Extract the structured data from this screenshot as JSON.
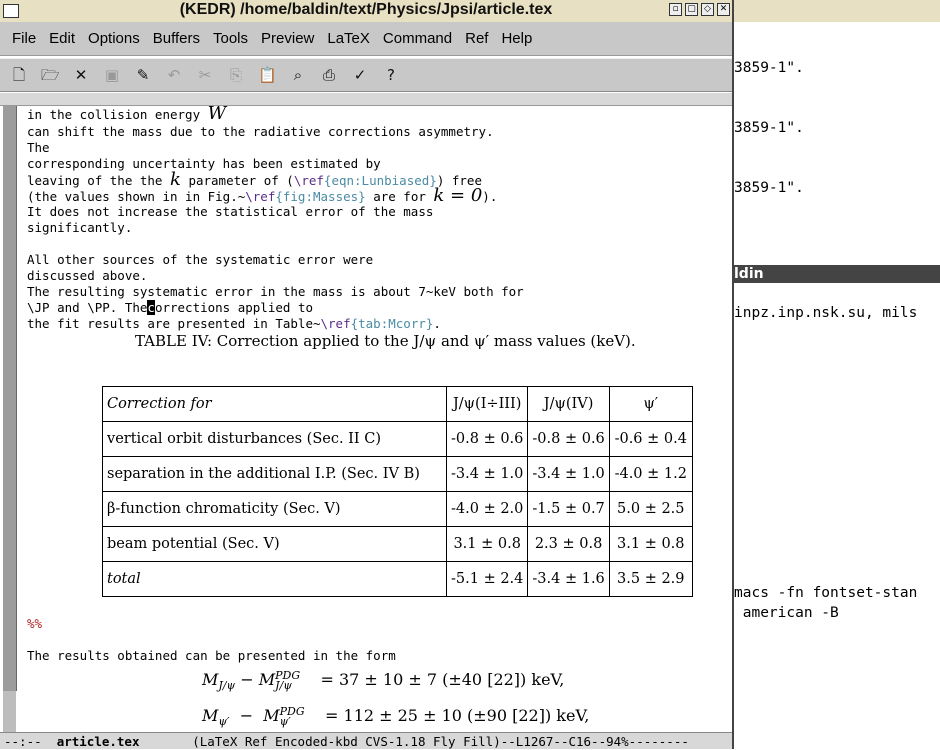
{
  "window": {
    "title": "(KEDR) /home/baldin/text/Physics/Jpsi/article.tex"
  },
  "menu": [
    "File",
    "Edit",
    "Options",
    "Buffers",
    "Tools",
    "Preview",
    "LaTeX",
    "Command",
    "Ref",
    "Help"
  ],
  "toolbar": [
    {
      "icon": "new-file-icon"
    },
    {
      "icon": "open-folder-icon"
    },
    {
      "icon": "close-icon"
    },
    {
      "icon": "save-icon",
      "disabled": true
    },
    {
      "icon": "save-as-icon"
    },
    {
      "icon": "undo-icon",
      "disabled": true
    },
    {
      "icon": "cut-icon",
      "disabled": true
    },
    {
      "icon": "copy-icon",
      "disabled": true
    },
    {
      "icon": "paste-icon"
    },
    {
      "icon": "search-icon"
    },
    {
      "icon": "print-icon"
    },
    {
      "icon": "customize-icon"
    },
    {
      "icon": "help-icon"
    }
  ],
  "editor": {
    "lines": [
      {
        "t": "in the collision energy ",
        "m": "W"
      },
      {
        "t": "can shift the mass due to the radiative corrections asymmetry."
      },
      {
        "t": "The"
      },
      {
        "t": "corresponding uncertainty has been estimated by"
      },
      {
        "t": "leaving of the the "
      },
      {
        "t": "(the values shown in in Fig.~"
      },
      {
        "t": "It does not increase the statistical error of the mass"
      },
      {
        "t": "significantly."
      },
      {
        "t": ""
      },
      {
        "t": "All other sources of the systematic error were"
      },
      {
        "t": "discussed above."
      },
      {
        "t": "The resulting systematic error in the mass is about 7~keV both for"
      },
      {
        "t": "\\JP and \\PP. The"
      },
      {
        "t": "the fit results are presented in Table~"
      }
    ],
    "line5": {
      "pre": "leaving of the the ",
      "k": "k",
      "mid": " parameter of (",
      "ref": "\\ref",
      "key": "{eqn:Lunbiased}",
      "post": ") free"
    },
    "line6": {
      "pre": "(the values shown in in Fig.~",
      "ref": "\\ref",
      "key": "{fig:Masses}",
      "mid": " are for ",
      "math": "k = 0",
      "post": ")."
    },
    "line13": {
      "pre": "\\JP and \\PP. The",
      "cursor": "c",
      "post": "orrections applied to"
    },
    "line14": {
      "pre": "the fit results are presented in Table~",
      "ref": "\\ref",
      "key": "{tab:Mcorr}",
      "post": "."
    },
    "caption": "TABLE IV: Correction applied to the J/ψ and ψ′ mass values (keV).",
    "table": {
      "headers": [
        "Correction for",
        "J/ψ(I÷III)",
        "J/ψ(IV)",
        "ψ′"
      ],
      "rows": [
        [
          "vertical orbit disturbances (Sec. II C)",
          "-0.8 ± 0.6",
          "-0.8 ± 0.6",
          "-0.6 ± 0.4"
        ],
        [
          "separation in the additional I.P. (Sec. IV B)",
          "-3.4 ± 1.0",
          "-3.4 ± 1.0",
          "-4.0 ± 1.2"
        ],
        [
          "β-function chromaticity (Sec. V)",
          "-4.0 ± 2.0",
          "-1.5 ± 0.7",
          "5.0 ± 2.5"
        ],
        [
          "beam potential (Sec. V)",
          "3.1 ± 0.8",
          "2.3 ± 0.8",
          "3.1 ± 0.8"
        ]
      ],
      "total": [
        "total",
        "-5.1 ± 2.4",
        "-3.4 ± 1.6",
        "3.5 ± 2.9"
      ]
    },
    "percent": "%%",
    "results_line": "The results obtained can be presented in the form",
    "eq1": "M_J/ψ − M^PDG_J/ψ  =  37 ± 10 ± 7 (±40 [22]) keV,",
    "eq2": "M_ψ′ − M^PDG_ψ′  = 112 ± 25 ± 10 (±90 [22]) keV,",
    "eq1_lhs": "M",
    "eq1_rhs": "=  37 ± 10 ± 7 (±40 [22]) keV,",
    "eq2_rhs": "= 112 ± 25 ± 10 (±90 [22]) keV,"
  },
  "modeline": {
    "status": "--:--",
    "buffer": "article.tex",
    "modes": "(LaTeX Ref Encoded-kbd CVS-1.18 Fly Fill)--L1267--C16--94%--------"
  },
  "terminal": {
    "lines": [
      "3859-1\".",
      "3859-1\".",
      "3859-1\"."
    ],
    "bar": "ldin",
    "line4": "inpz.inp.nsk.su, mils",
    "line5": "macs -fn fontset-stan",
    "line6": " american -B"
  }
}
